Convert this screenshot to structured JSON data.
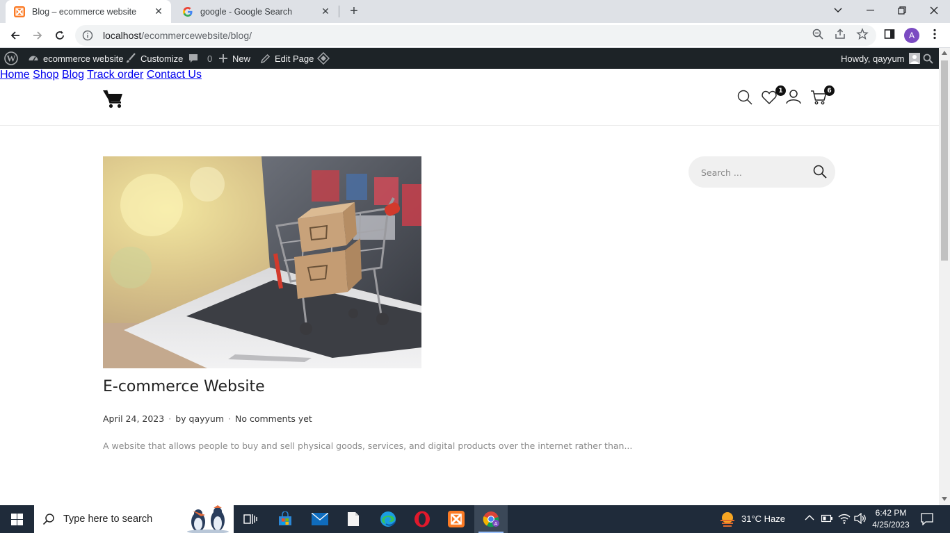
{
  "browser": {
    "tabs": [
      {
        "title": "Blog – ecommerce website",
        "favicon": "xampp-icon",
        "active": true
      },
      {
        "title": "google - Google Search",
        "favicon": "google-g-icon",
        "active": false
      }
    ],
    "url_host": "localhost",
    "url_path": "/ecommercewebsite/blog/",
    "profile_initial": "A"
  },
  "admin_bar": {
    "site_name": "ecommerce website",
    "customize": "Customize",
    "comments_count": "0",
    "new": "New",
    "edit_page": "Edit Page",
    "howdy": "Howdy, qayyum"
  },
  "site": {
    "nav": [
      "Home",
      "Shop",
      "Blog",
      "Track order",
      "Contact Us"
    ],
    "wishlist_count": "1",
    "cart_count": "6"
  },
  "post": {
    "title": "E-commerce Website",
    "date": "April 24, 2023",
    "author": "by qayyum",
    "comments": "No comments yet",
    "excerpt": "A website that allows people to buy and sell physical goods, services, and digital products over the internet rather than..."
  },
  "sidebar": {
    "search_placeholder": "Search ..."
  },
  "taskbar": {
    "search_placeholder": "Type here to search",
    "weather": "31°C  Haze",
    "time": "6:42 PM",
    "date": "4/25/2023"
  }
}
